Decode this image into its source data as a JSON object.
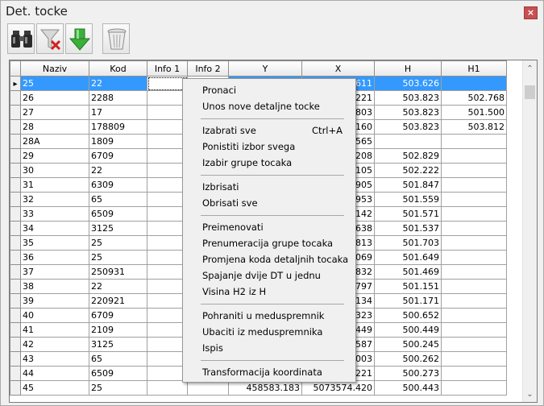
{
  "window": {
    "title": "Det. tocke",
    "close_label": "×"
  },
  "toolbar": {
    "buttons": [
      {
        "name": "find",
        "icon": "binoculars-icon"
      },
      {
        "name": "clear-filter",
        "icon": "funnel-remove-icon"
      },
      {
        "name": "import",
        "icon": "green-down-arrow-icon"
      },
      {
        "name": "delete",
        "icon": "trash-bin-icon"
      }
    ]
  },
  "table": {
    "columns": [
      "Naziv",
      "Kod",
      "Info 1",
      "Info 2",
      "Y",
      "X",
      "H",
      "H1"
    ],
    "row_indicator": "▸",
    "rows": [
      [
        "25",
        "22",
        "",
        "",
        "",
        "611",
        "503.626",
        ""
      ],
      [
        "26",
        "2288",
        "",
        "",
        "",
        "221",
        "503.823",
        "502.768"
      ],
      [
        "27",
        "17",
        "",
        "",
        "",
        "803",
        "503.823",
        "501.500"
      ],
      [
        "28",
        "178809",
        "",
        "",
        "",
        "160",
        "503.823",
        "503.812"
      ],
      [
        "28A",
        "1809",
        "",
        "",
        "",
        "565",
        "",
        ""
      ],
      [
        "29",
        "6709",
        "",
        "",
        "",
        "208",
        "502.829",
        ""
      ],
      [
        "30",
        "22",
        "",
        "",
        "",
        "105",
        "502.222",
        ""
      ],
      [
        "31",
        "6309",
        "",
        "",
        "",
        "905",
        "501.847",
        ""
      ],
      [
        "32",
        "65",
        "",
        "",
        "",
        "953",
        "501.559",
        ""
      ],
      [
        "33",
        "6509",
        "",
        "",
        "",
        "142",
        "501.571",
        ""
      ],
      [
        "34",
        "3125",
        "",
        "",
        "",
        "638",
        "501.537",
        ""
      ],
      [
        "35",
        "25",
        "",
        "",
        "",
        "813",
        "501.703",
        ""
      ],
      [
        "36",
        "25",
        "",
        "",
        "",
        "069",
        "501.649",
        ""
      ],
      [
        "37",
        "250931",
        "",
        "",
        "",
        "832",
        "501.469",
        ""
      ],
      [
        "38",
        "22",
        "",
        "",
        "",
        "797",
        "501.151",
        ""
      ],
      [
        "39",
        "220921",
        "",
        "",
        "",
        "134",
        "501.171",
        ""
      ],
      [
        "40",
        "6709",
        "",
        "",
        "",
        "323",
        "500.652",
        ""
      ],
      [
        "41",
        "2109",
        "",
        "",
        "",
        "449",
        "500.449",
        ""
      ],
      [
        "42",
        "3125",
        "",
        "",
        "",
        "587",
        "500.245",
        ""
      ],
      [
        "43",
        "65",
        "",
        "",
        "",
        "003",
        "500.262",
        ""
      ],
      [
        "44",
        "6509",
        "",
        "",
        "",
        "221",
        "500.273",
        ""
      ],
      [
        "45",
        "25",
        "",
        "",
        "458583.183",
        "5073574.420",
        "500.443",
        ""
      ]
    ]
  },
  "scrollbar": {
    "up": "⌃",
    "down": "⌄"
  },
  "context_menu": {
    "items": [
      {
        "label": "Pronaci",
        "shortcut": ""
      },
      {
        "label": "Unos nove detaljne tocke",
        "shortcut": ""
      },
      {
        "label": "Izabrati sve",
        "shortcut": "Ctrl+A"
      },
      {
        "label": "Ponistiti izbor svega",
        "shortcut": ""
      },
      {
        "label": "Izabir grupe tocaka",
        "shortcut": ""
      },
      {
        "label": "Izbrisati",
        "shortcut": ""
      },
      {
        "label": "Obrisati sve",
        "shortcut": ""
      },
      {
        "label": "Preimenovati",
        "shortcut": ""
      },
      {
        "label": "Prenumeracija grupe tocaka",
        "shortcut": ""
      },
      {
        "label": "Promjena koda detaljnih tocaka",
        "shortcut": ""
      },
      {
        "label": "Spajanje dvije DT u jednu",
        "shortcut": ""
      },
      {
        "label": "Visina H2 iz H",
        "shortcut": ""
      },
      {
        "label": "Pohraniti u meduspremnik",
        "shortcut": ""
      },
      {
        "label": "Ubaciti iz meduspremnika",
        "shortcut": ""
      },
      {
        "label": "Ispis",
        "shortcut": ""
      },
      {
        "label": "Transformacija koordinata",
        "shortcut": ""
      }
    ]
  },
  "colors": {
    "selection": "#3399ff",
    "close": "#c75050",
    "arrow_green": "#3cae3c"
  }
}
